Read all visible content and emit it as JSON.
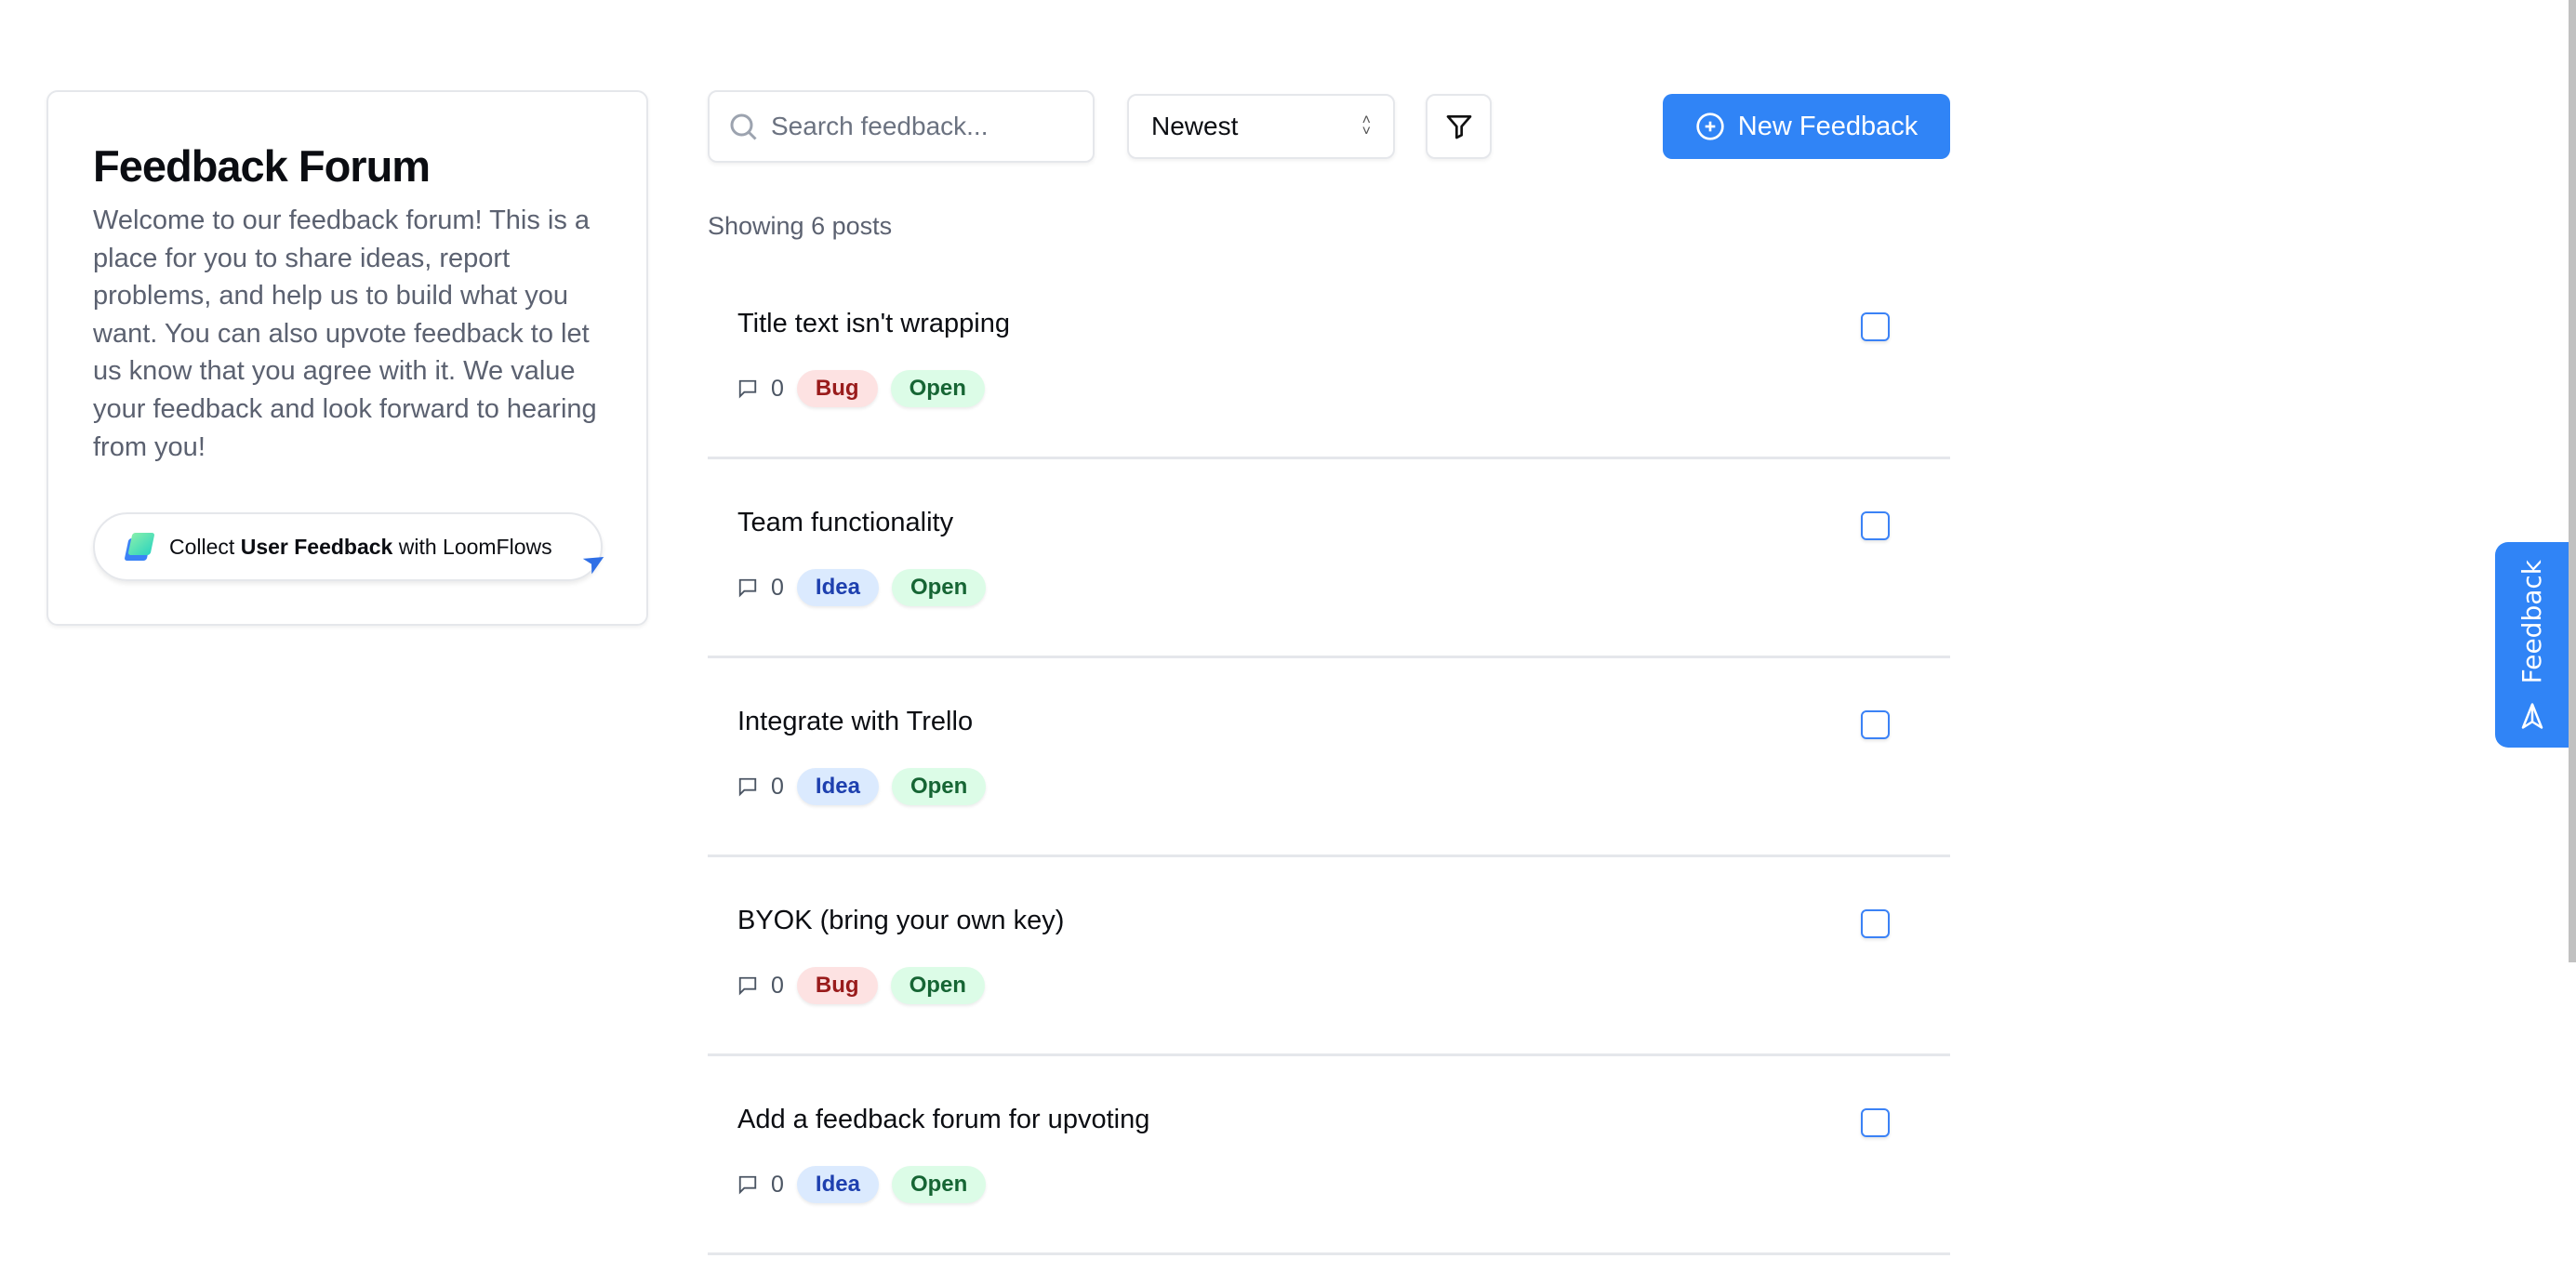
{
  "sidebar": {
    "title": "Feedback Forum",
    "description": "Welcome to our feedback forum! This is a place for you to share ideas, report problems, and help us to build what you want. You can also upvote feedback to let us know that you agree with it. We value your feedback and look forward to hearing from you!",
    "promo": {
      "prefix": "Collect",
      "bold": "User Feedback",
      "suffix": "with LoomFlows"
    }
  },
  "toolbar": {
    "search_placeholder": "Search feedback...",
    "search_value": "",
    "sort": "Newest",
    "new_label": "New Feedback"
  },
  "showing": "Showing 6 posts",
  "posts": [
    {
      "title": "Title text isn't wrapping",
      "comments": "0",
      "type": "Bug",
      "status": "Open"
    },
    {
      "title": "Team functionality",
      "comments": "0",
      "type": "Idea",
      "status": "Open"
    },
    {
      "title": "Integrate with Trello",
      "comments": "0",
      "type": "Idea",
      "status": "Open"
    },
    {
      "title": "BYOK (bring your own key)",
      "comments": "0",
      "type": "Bug",
      "status": "Open"
    },
    {
      "title": "Add a feedback forum for upvoting",
      "comments": "0",
      "type": "Idea",
      "status": "Open"
    }
  ],
  "side_tab": {
    "label": "Feedback"
  },
  "colors": {
    "accent": "#3084f6",
    "bug_bg": "#fde2e2",
    "idea_bg": "#dbeafe",
    "open_bg": "#dcfce7"
  }
}
